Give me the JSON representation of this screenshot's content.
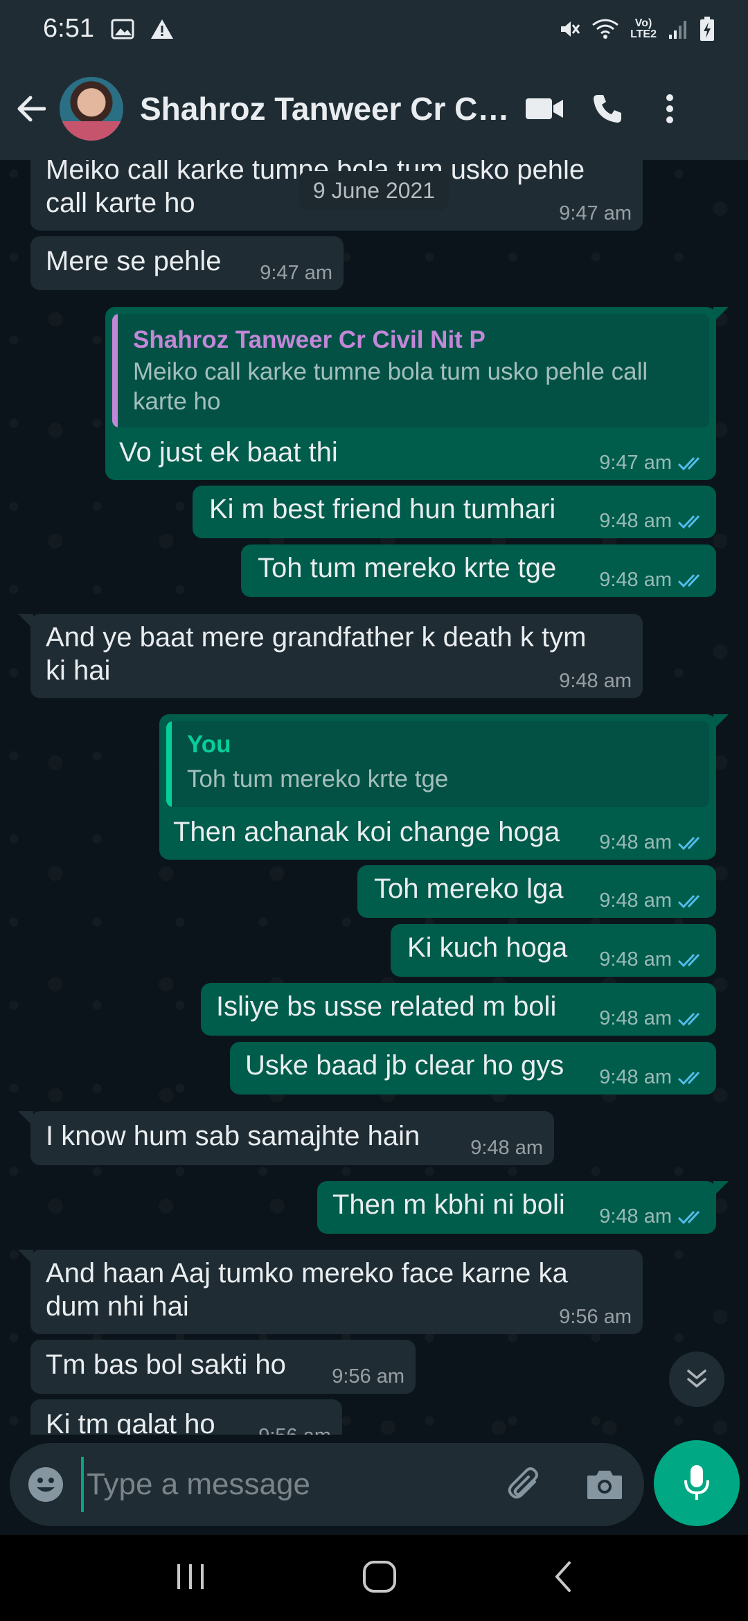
{
  "status_bar": {
    "time": "6:51",
    "network_label_top": "Vo)",
    "network_label_bottom": "LTE2"
  },
  "header": {
    "contact_name": "Shahroz Tanweer Cr Civ..."
  },
  "date_chip": "9 June 2021",
  "messages": [
    {
      "dir": "in",
      "text": "Meiko call karke tumne bola tum usko pehle\ncall karte ho",
      "time": "9:47 am"
    },
    {
      "dir": "in",
      "text": "Mere se pehle",
      "time": "9:47 am"
    },
    {
      "dir": "out",
      "quote_name": "Shahroz Tanweer Cr Civil Nit P",
      "quote_text": "Meiko call karke tumne bola tum usko pehle call karte ho",
      "text": "Vo just ek baat thi",
      "time": "9:47 am"
    },
    {
      "dir": "out",
      "text": "Ki m best friend hun tumhari",
      "time": "9:48 am"
    },
    {
      "dir": "out",
      "text": "Toh tum mereko krte tge",
      "time": "9:48 am"
    },
    {
      "dir": "in",
      "text": "And ye baat mere grandfather k death k tym\nki hai",
      "time": "9:48 am"
    },
    {
      "dir": "out",
      "quote_name": "You",
      "quote_text": "Toh tum mereko krte tge",
      "text": "Then achanak koi change hoga",
      "time": "9:48 am"
    },
    {
      "dir": "out",
      "text": "Toh mereko lga",
      "time": "9:48 am"
    },
    {
      "dir": "out",
      "text": "Ki kuch hoga",
      "time": "9:48 am"
    },
    {
      "dir": "out",
      "text": "Isliye bs usse related m boli",
      "time": "9:48 am"
    },
    {
      "dir": "out",
      "text": "Uske baad jb clear ho gys",
      "time": "9:48 am"
    },
    {
      "dir": "in",
      "text": "I know hum sab samajhte hain",
      "time": "9:48 am"
    },
    {
      "dir": "out",
      "text": "Then m kbhi ni boli",
      "time": "9:48 am"
    },
    {
      "dir": "in",
      "text": "And haan Aaj tumko mereko face karne ka\ndum nhi hai",
      "time": "9:56 am"
    },
    {
      "dir": "in",
      "text": "Tm bas bol sakti ho",
      "time": "9:56 am"
    },
    {
      "dir": "in",
      "text": "Ki tm galat ho",
      "time": "9:56 am"
    }
  ],
  "composer": {
    "placeholder": "Type a message"
  },
  "colors": {
    "incoming": "#1f2c34",
    "outgoing": "#005c4b",
    "accent": "#00a884",
    "read_tick": "#53bdeb",
    "quote_other": "#c387d8",
    "quote_you": "#06cf9c"
  }
}
